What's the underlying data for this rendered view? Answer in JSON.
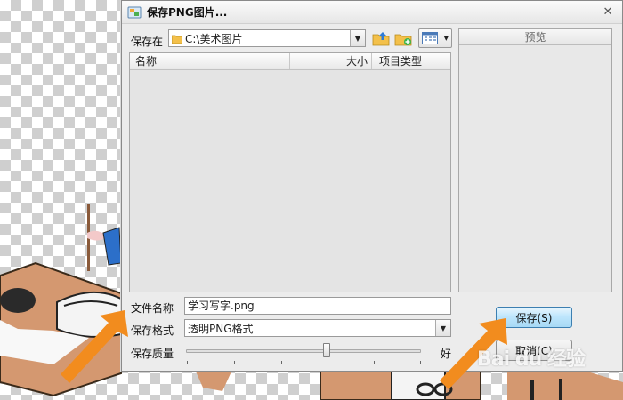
{
  "dialog": {
    "title": "保存PNG图片...",
    "close_glyph": "✕",
    "save_in_label": "保存在",
    "save_in_path": "C:\\美术图片",
    "columns": [
      "名称",
      "大小",
      "项目类型"
    ],
    "preview_label": "预览",
    "filename_label": "文件名称",
    "filename_value": "学习写字.png",
    "format_label": "保存格式",
    "format_value": "透明PNG格式",
    "quality_label": "保存质量",
    "quality_end_label": "好",
    "quality_level": 0.6,
    "save_button": "保存(S)",
    "cancel_button": "取消(C)"
  },
  "toolbar_icons": [
    "folder-up-icon",
    "new-folder-icon",
    "view-menu-icon"
  ],
  "watermark": "Bai du 经验",
  "colors": {
    "annotation_arrow": "#f28c1e",
    "save_button_bg": "#bee6fd",
    "dialog_bg": "#ececec"
  }
}
